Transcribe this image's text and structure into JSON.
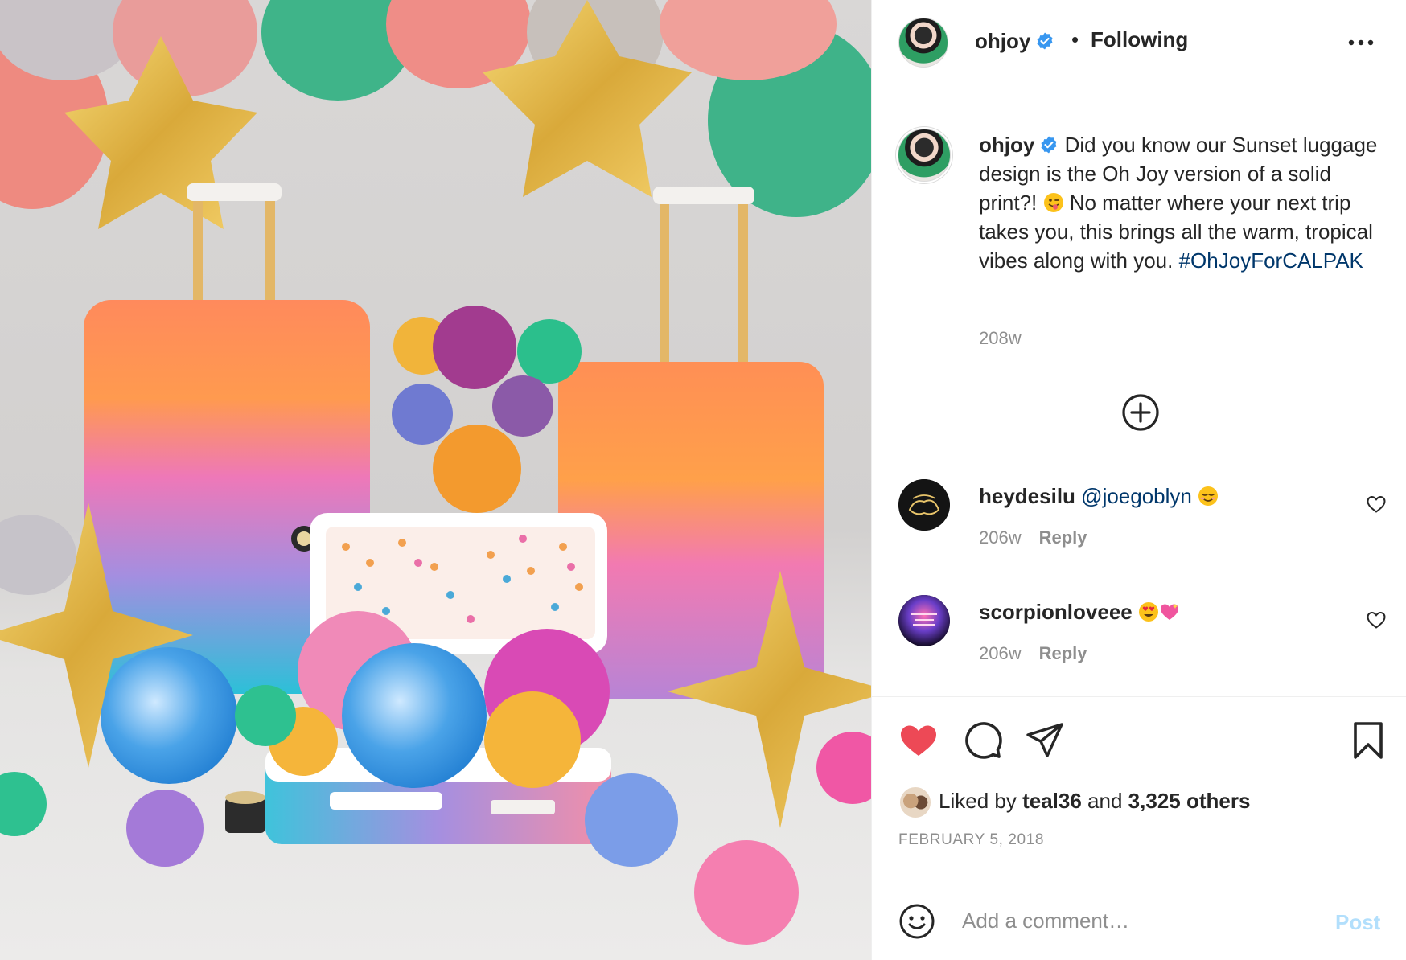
{
  "post": {
    "photo_alt": "",
    "header": {
      "username": "ohjoy",
      "separator": "•",
      "follow_status": "Following"
    },
    "caption": {
      "username": "ohjoy",
      "text_part1": "Did you know our Sunset luggage design is the Oh Joy version of a solid print?! ",
      "text_part2": " No matter where your next trip takes you, this brings all the warm, tropical vibes along with you. ",
      "hashtag": "#OhJoyForCALPAK",
      "time": "208w"
    },
    "comments": [
      {
        "username": "heydesilu",
        "mention": "@joegoblyn",
        "time": "206w",
        "reply_label": "Reply"
      },
      {
        "username": "scorpionloveee",
        "time": "206w",
        "reply_label": "Reply"
      }
    ],
    "likes": {
      "prefix": "Liked by",
      "first_user": "teal36",
      "joiner": "and",
      "others": "3,325 others"
    },
    "date": "FEBRUARY 5, 2018",
    "comment_box": {
      "placeholder": "Add a comment…",
      "post_label": "Post"
    },
    "colors": {
      "like_red": "#ed4956",
      "link_blue": "#00376b",
      "verified_blue": "#3897f0",
      "post_disabled": "#b2dffc",
      "muted_gray": "#8e8e8e"
    },
    "icons": {
      "like": "heart-filled-icon",
      "comment": "comment-bubble-icon",
      "share": "paper-plane-icon",
      "save": "bookmark-icon",
      "more": "more-horizontal-icon",
      "add": "circle-plus-icon",
      "emoji": "smiley-icon"
    }
  }
}
